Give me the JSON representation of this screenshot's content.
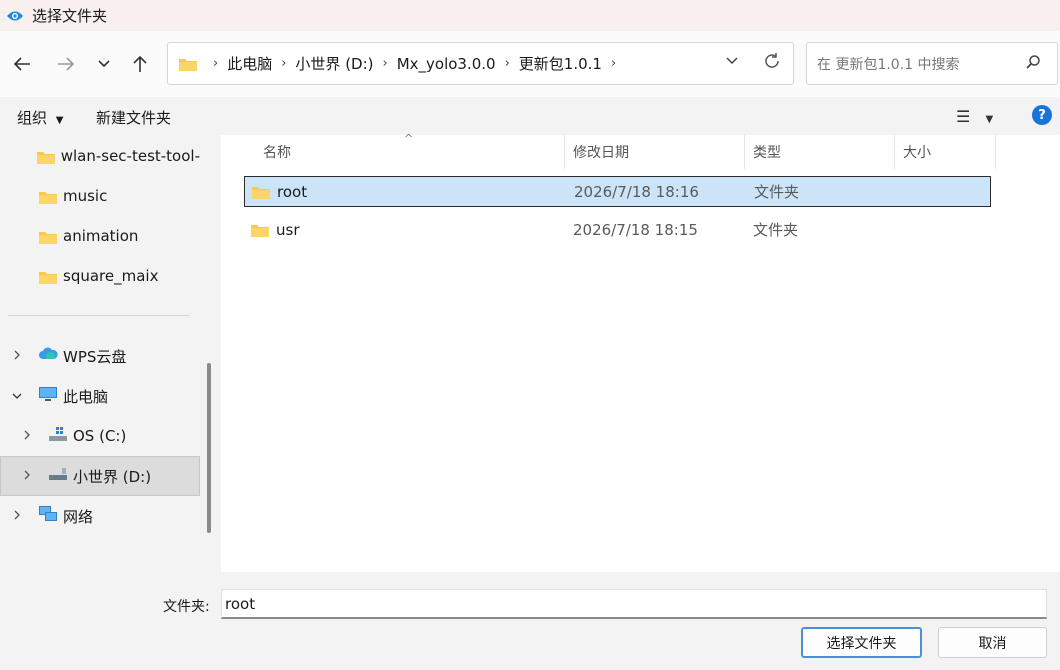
{
  "window": {
    "title": "选择文件夹"
  },
  "address": {
    "crumbs": [
      "此电脑",
      "小世界 (D:)",
      "Mx_yolo3.0.0",
      "更新包1.0.1"
    ]
  },
  "search": {
    "placeholder": "在 更新包1.0.1 中搜索"
  },
  "toolbar": {
    "organize": "组织",
    "new_folder": "新建文件夹"
  },
  "sidebar": {
    "quick_items": [
      {
        "label": "wlan-sec-test-tool-"
      },
      {
        "label": "music"
      },
      {
        "label": "animation"
      },
      {
        "label": "square_maix"
      }
    ],
    "tree": [
      {
        "label": "WPS云盘",
        "icon": "cloud-icon",
        "expanded": false
      },
      {
        "label": "此电脑",
        "icon": "computer-icon",
        "expanded": true
      },
      {
        "label": "OS (C:)",
        "icon": "drive-c-icon",
        "expanded": false
      },
      {
        "label": "小世界 (D:)",
        "icon": "drive-d-icon",
        "expanded": false,
        "selected": true
      },
      {
        "label": "网络",
        "icon": "network-icon",
        "expanded": false
      }
    ]
  },
  "columns": {
    "name": "名称",
    "modified": "修改日期",
    "type": "类型",
    "size": "大小"
  },
  "files": [
    {
      "name": "root",
      "modified": "2026/7/18 18:16",
      "type": "文件夹",
      "selected": true
    },
    {
      "name": "usr",
      "modified": "2026/7/18 18:15",
      "type": "文件夹",
      "selected": false
    }
  ],
  "footer": {
    "folder_label": "文件夹:",
    "folder_value": "root",
    "select_button": "选择文件夹",
    "cancel_button": "取消"
  },
  "colors": {
    "selection": "#cce4f7",
    "folder": "#f8c94a",
    "accent": "#1a73d9"
  }
}
